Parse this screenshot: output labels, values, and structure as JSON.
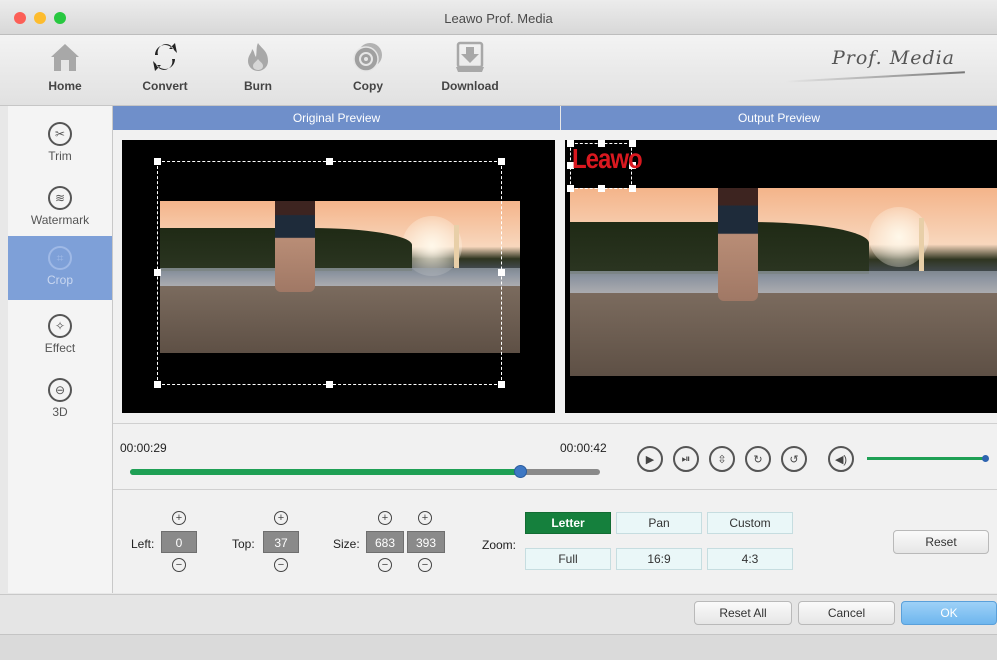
{
  "window": {
    "title": "Leawo Prof. Media"
  },
  "toolbar": {
    "items": [
      {
        "label": "Home",
        "icon": "home-icon"
      },
      {
        "label": "Convert",
        "icon": "convert-icon"
      },
      {
        "label": "Burn",
        "icon": "burn-icon"
      },
      {
        "label": "Copy",
        "icon": "copy-icon"
      },
      {
        "label": "Download",
        "icon": "download-icon"
      }
    ],
    "brand": "Prof. Media"
  },
  "sidebar": {
    "items": [
      {
        "label": "Trim",
        "icon": "scissors-icon"
      },
      {
        "label": "Watermark",
        "icon": "watermark-icon"
      },
      {
        "label": "Crop",
        "icon": "crop-icon",
        "active": true
      },
      {
        "label": "Effect",
        "icon": "effect-icon"
      },
      {
        "label": "3D",
        "icon": "3d-glasses-icon"
      }
    ]
  },
  "preview": {
    "original_label": "Original Preview",
    "output_label": "Output Preview",
    "watermark_text": "Leawo"
  },
  "player": {
    "current_time": "00:00:29",
    "end_time": "00:00:42",
    "progress_fraction": 0.83,
    "volume_fraction": 0.98
  },
  "crop": {
    "left_label": "Left:",
    "left_value": "0",
    "top_label": "Top:",
    "top_value": "37",
    "size_label": "Size:",
    "width_value": "683",
    "height_value": "393",
    "zoom_label": "Zoom:",
    "zoom_options": [
      "Letter",
      "Pan",
      "Custom",
      "Full",
      "16:9",
      "4:3"
    ],
    "zoom_selected": "Letter",
    "reset_label": "Reset"
  },
  "footer": {
    "reset_all_label": "Reset All",
    "cancel_label": "Cancel",
    "ok_label": "OK"
  },
  "colors": {
    "accent_header": "#6f8fca",
    "active_sidebar": "#7ea0d8",
    "progress": "#1fa055",
    "zoom_active": "#15803d",
    "watermark": "#d9181f"
  }
}
